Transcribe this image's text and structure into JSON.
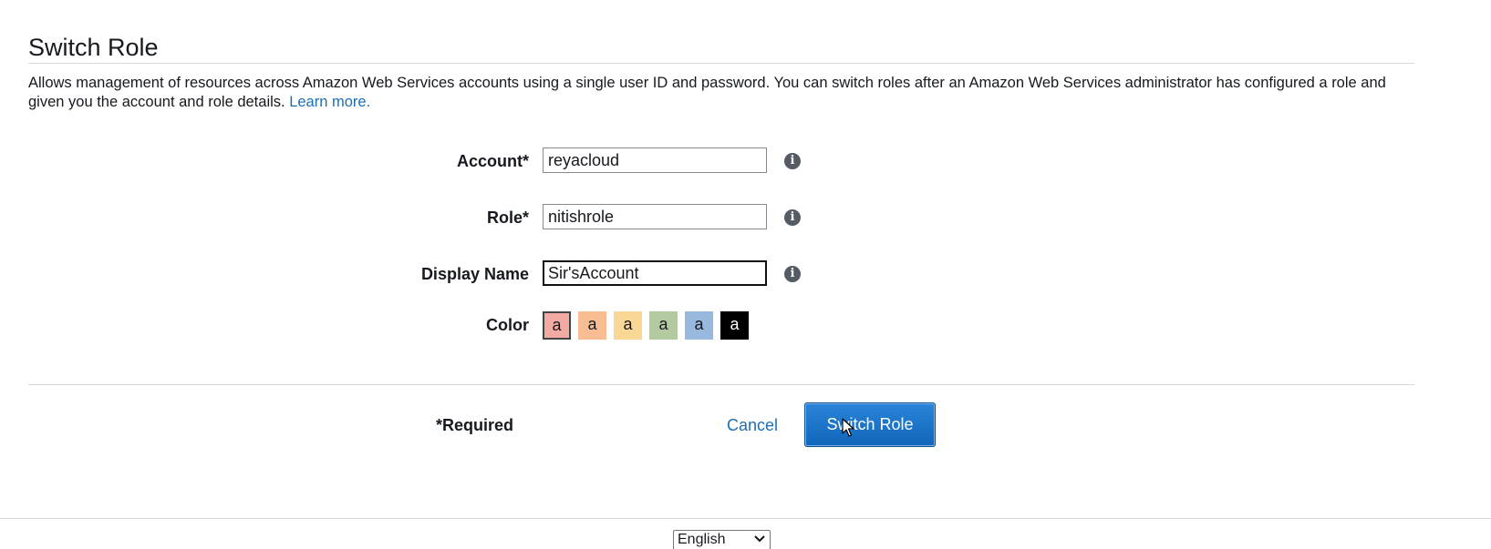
{
  "page": {
    "title": "Switch Role",
    "description": "Allows management of resources across Amazon Web Services accounts using a single user ID and password. You can switch roles after an Amazon Web Services administrator has configured a role and given you the account and role details.",
    "learn_more": "Learn more."
  },
  "form": {
    "account": {
      "label": "Account*",
      "value": "reyacloud"
    },
    "role": {
      "label": "Role*",
      "value": "nitishrole"
    },
    "display_name": {
      "label": "Display Name",
      "value": "Sir'sAccount"
    },
    "color": {
      "label": "Color",
      "swatches": [
        {
          "letter": "a",
          "color": "#f2aaa3",
          "selected": true
        },
        {
          "letter": "a",
          "color": "#f8bd93"
        },
        {
          "letter": "a",
          "color": "#f9d896"
        },
        {
          "letter": "a",
          "color": "#b3c99f"
        },
        {
          "letter": "a",
          "color": "#98b8de"
        },
        {
          "letter": "a",
          "color": "#000000",
          "text_color": "#ffffff"
        }
      ]
    },
    "info_icon": "info-icon"
  },
  "footer": {
    "required_note": "*Required",
    "cancel_label": "Cancel",
    "submit_label": "Switch Role",
    "language": "English"
  },
  "colors": {
    "link": "#1b6fb5",
    "primary_button": "#1166bb",
    "rule": "#d5dbdb"
  }
}
